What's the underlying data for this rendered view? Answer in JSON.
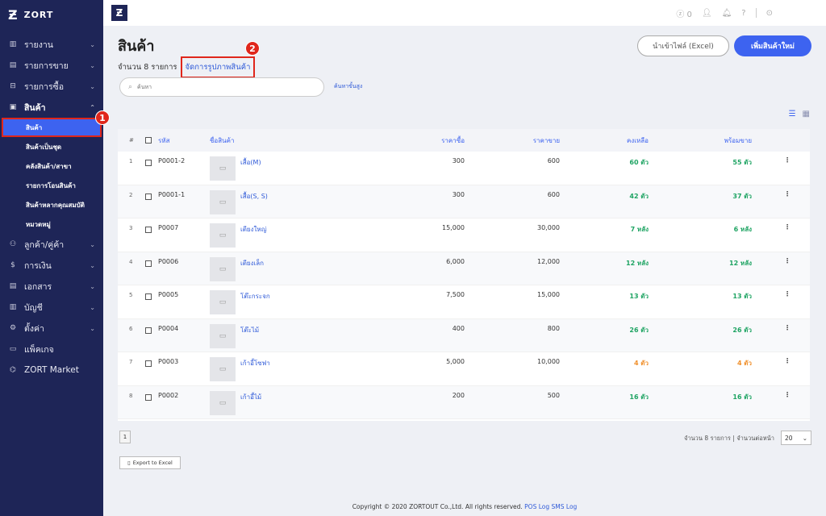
{
  "brand": {
    "mark": "Ƶ",
    "name": "ZORT"
  },
  "sidebar": {
    "items": [
      {
        "icon": "chart-icon",
        "glyph": "▥",
        "label": "รายงาน",
        "chevron": "⌄"
      },
      {
        "icon": "receipt-icon",
        "glyph": "▤",
        "label": "รายการขาย",
        "chevron": "⌄"
      },
      {
        "icon": "basket-icon",
        "glyph": "⊟",
        "label": "รายการซื้อ",
        "chevron": "⌄"
      },
      {
        "icon": "box-icon",
        "glyph": "▣",
        "label": "สินค้า",
        "chevron": "⌃"
      }
    ],
    "sub_items": [
      "สินค้า",
      "สินค้าเป็นชุด",
      "คลังสินค้า/สาขา",
      "รายการโอนสินค้า",
      "สินค้าหลากคุณสมบัติ",
      "หมวดหมู่"
    ],
    "items2": [
      {
        "icon": "users-icon",
        "glyph": "⚇",
        "label": "ลูกค้า/คู่ค้า",
        "chevron": "⌄"
      },
      {
        "icon": "money-icon",
        "glyph": "$",
        "label": "การเงิน",
        "chevron": "⌄"
      },
      {
        "icon": "document-icon",
        "glyph": "▤",
        "label": "เอกสาร",
        "chevron": "⌄"
      },
      {
        "icon": "ledger-icon",
        "glyph": "▥",
        "label": "บัญชี",
        "chevron": "⌄"
      },
      {
        "icon": "gear-icon",
        "glyph": "⚙",
        "label": "ตั้งค่า",
        "chevron": "⌄"
      },
      {
        "icon": "package-icon",
        "glyph": "▭",
        "label": "แพ็คเกจ",
        "chevron": ""
      },
      {
        "icon": "market-icon",
        "glyph": "⌬",
        "label": "ZORT Market",
        "chevron": ""
      }
    ]
  },
  "topbar": {
    "coins": "0"
  },
  "annotations": {
    "one": "1",
    "two": "2"
  },
  "page": {
    "title": "สินค้า",
    "count_text": "จำนวน 8 รายการ",
    "manage_link": "จัดการรูปภาพสินค้า",
    "import_button": "นำเข้าไฟล์ (Excel)",
    "add_button": "เพิ่มสินค้าใหม่",
    "search_placeholder": "ค้นหา",
    "advanced_search": "ค้นหาขั้นสูง"
  },
  "table": {
    "headers": {
      "num": "#",
      "code": "รหัส",
      "name": "ชื่อสินค้า",
      "buy": "ราคาซื้อ",
      "sell": "ราคาขาย",
      "remaining": "คงเหลือ",
      "available": "พร้อมขาย"
    },
    "rows": [
      {
        "num": "1",
        "code": "P0001-2",
        "name": "เสื้อ(M)",
        "buy": "300",
        "sell": "600",
        "remaining": "60 ตัว",
        "available": "55 ตัว",
        "warn": false
      },
      {
        "num": "2",
        "code": "P0001-1",
        "name": "เสื้อ(S, S)",
        "buy": "300",
        "sell": "600",
        "remaining": "42 ตัว",
        "available": "37 ตัว",
        "warn": false
      },
      {
        "num": "3",
        "code": "P0007",
        "name": "เตียงใหญ่",
        "buy": "15,000",
        "sell": "30,000",
        "remaining": "7 หลัง",
        "available": "6 หลัง",
        "warn": false
      },
      {
        "num": "4",
        "code": "P0006",
        "name": "เตียงเล็ก",
        "buy": "6,000",
        "sell": "12,000",
        "remaining": "12 หลัง",
        "available": "12 หลัง",
        "warn": false
      },
      {
        "num": "5",
        "code": "P0005",
        "name": "โต๊ะกระจก",
        "buy": "7,500",
        "sell": "15,000",
        "remaining": "13 ตัว",
        "available": "13 ตัว",
        "warn": false
      },
      {
        "num": "6",
        "code": "P0004",
        "name": "โต๊ะไม้",
        "buy": "400",
        "sell": "800",
        "remaining": "26 ตัว",
        "available": "26 ตัว",
        "warn": false
      },
      {
        "num": "7",
        "code": "P0003",
        "name": "เก้าอี้โซฟา",
        "buy": "5,000",
        "sell": "10,000",
        "remaining": "4 ตัว",
        "available": "4 ตัว",
        "warn": true
      },
      {
        "num": "8",
        "code": "P0002",
        "name": "เก้าอี้ไม้",
        "buy": "200",
        "sell": "500",
        "remaining": "16 ตัว",
        "available": "16 ตัว",
        "warn": false
      }
    ]
  },
  "pager": {
    "page": "1",
    "info": "จำนวน 8 รายการ | จำนวนต่อหน้า",
    "per_page": "20"
  },
  "export_button": "Export to Excel",
  "footer": {
    "text": "Copyright © 2020 ZORTOUT Co.,Ltd. All rights reserved.",
    "pos": "POS",
    "log": "Log",
    "sms": "SMS Log"
  }
}
